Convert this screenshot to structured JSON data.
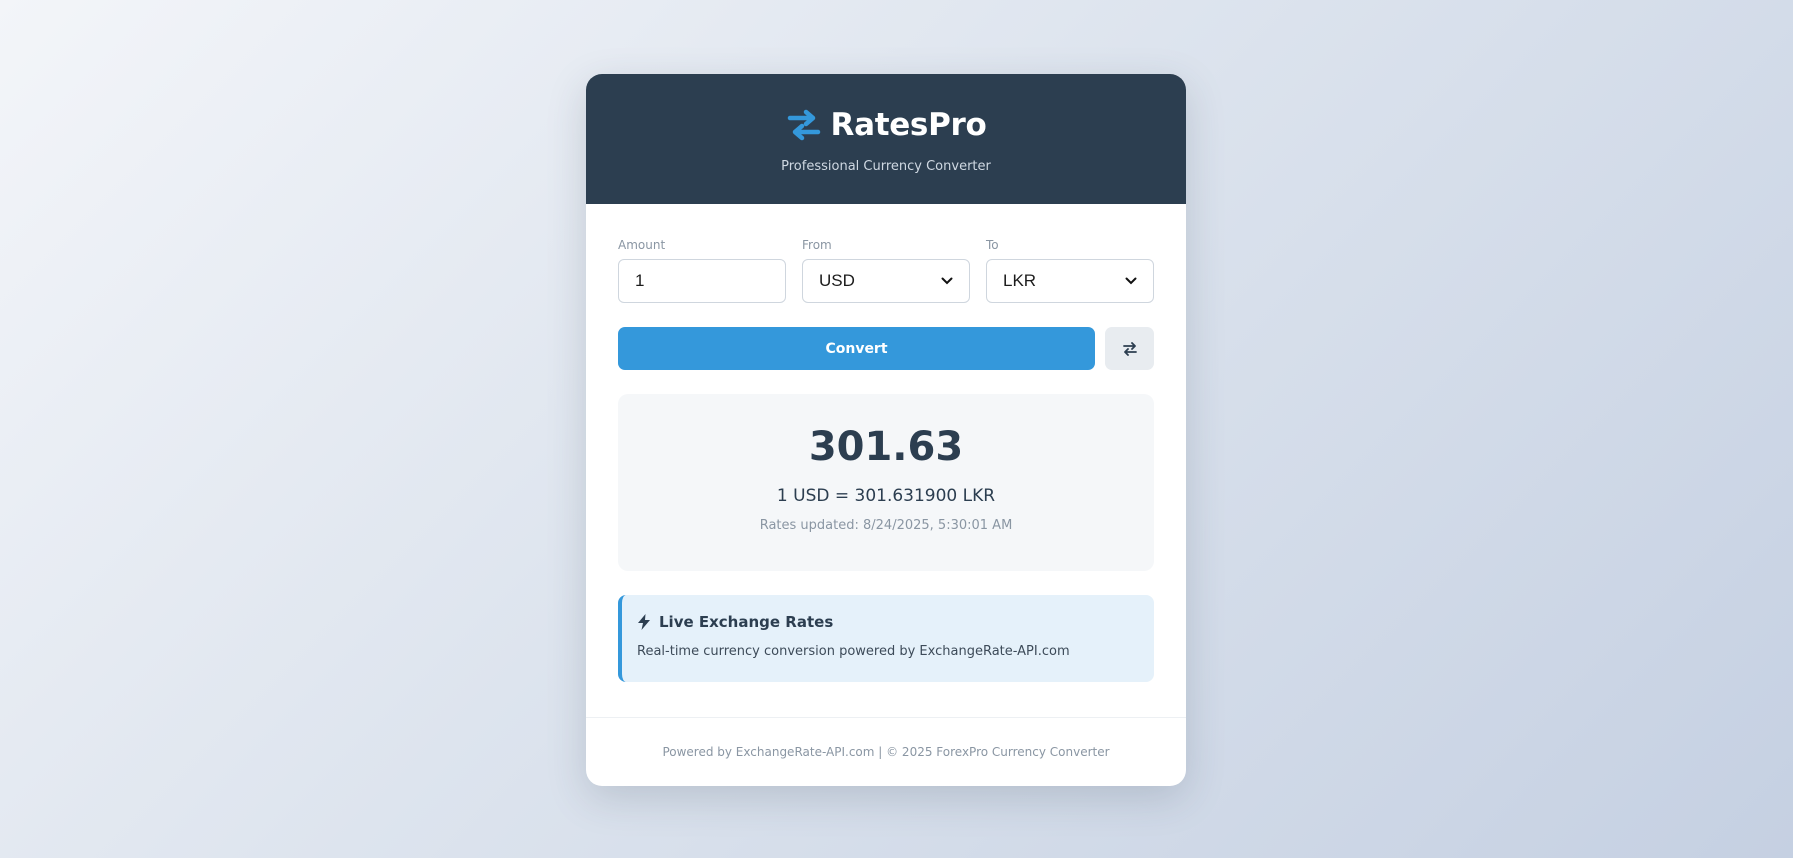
{
  "header": {
    "app_name": "RatesPro",
    "tagline": "Professional Currency Converter",
    "logo_icon": "exchange-arrows-icon"
  },
  "form": {
    "amount": {
      "label": "Amount",
      "value": "1"
    },
    "from": {
      "label": "From",
      "selected": "USD"
    },
    "to": {
      "label": "To",
      "selected": "LKR"
    }
  },
  "actions": {
    "convert_label": "Convert",
    "swap_icon": "swap-icon"
  },
  "result": {
    "converted_amount": "301.63",
    "rate_text": "1 USD = 301.631900 LKR",
    "updated_text": "Rates updated: 8/24/2025, 5:30:01 AM"
  },
  "info": {
    "title": "Live Exchange Rates",
    "description": "Real-time currency conversion powered by ExchangeRate-API.com",
    "icon": "bolt-icon"
  },
  "footer": {
    "text": "Powered by ExchangeRate-API.com | © 2025 ForexPro Currency Converter"
  },
  "colors": {
    "header_bg": "#2c3e50",
    "accent": "#3498db",
    "result_bg": "#f5f7f9",
    "info_bg": "#e5f1fa"
  }
}
